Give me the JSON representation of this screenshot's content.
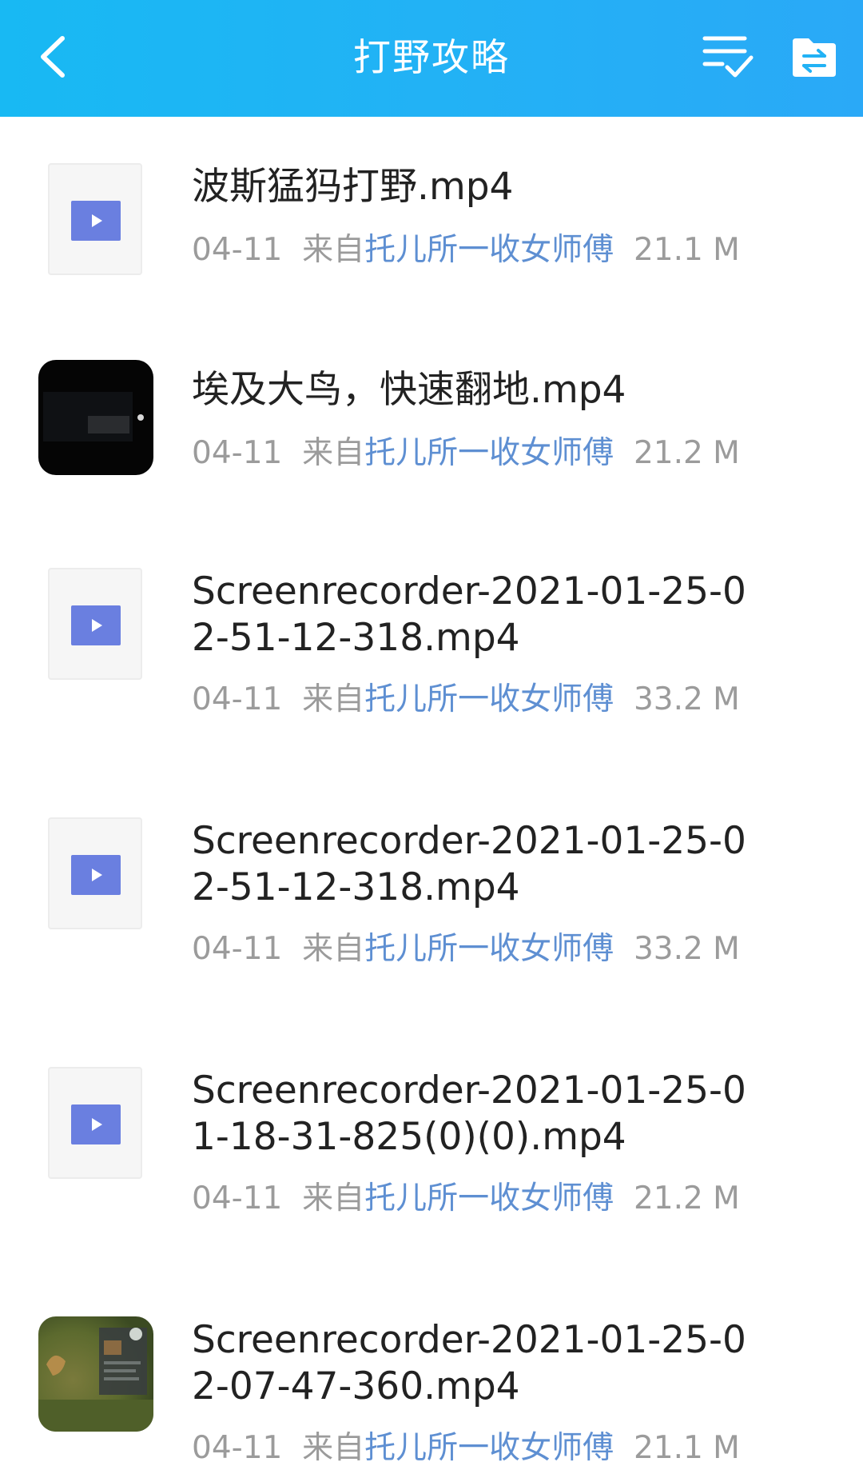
{
  "header": {
    "title": "打野攻略",
    "back_icon": "chevron-left-icon",
    "multi_select_icon": "checklist-icon",
    "folder_icon": "folder-transfer-icon",
    "background_color": "#1db5f4"
  },
  "files": [
    {
      "name": "波斯猛犸打野.mp4",
      "date": "04-11",
      "from_label": "来自",
      "source": "托儿所一收女师傅",
      "size": "21.1 M",
      "thumbnail": "video-placeholder-icon"
    },
    {
      "name": "埃及大鸟，快速翻地.mp4",
      "date": "04-11",
      "from_label": "来自",
      "source": "托儿所一收女师傅",
      "size": "21.2 M",
      "thumbnail": "dark-video-thumbnail"
    },
    {
      "name": "Screenrecorder-2021-01-25-02-51-12-318.mp4",
      "date": "04-11",
      "from_label": "来自",
      "source": "托儿所一收女师傅",
      "size": "33.2 M",
      "thumbnail": "video-placeholder-icon"
    },
    {
      "name": "Screenrecorder-2021-01-25-02-51-12-318.mp4",
      "date": "04-11",
      "from_label": "来自",
      "source": "托儿所一收女师傅",
      "size": "33.2 M",
      "thumbnail": "video-placeholder-icon"
    },
    {
      "name": "Screenrecorder-2021-01-25-01-18-31-825(0)(0).mp4",
      "date": "04-11",
      "from_label": "来自",
      "source": "托儿所一收女师傅",
      "size": "21.2 M",
      "thumbnail": "video-placeholder-icon"
    },
    {
      "name": "Screenrecorder-2021-01-25-02-07-47-360.mp4",
      "date": "04-11",
      "from_label": "来自",
      "source": "托儿所一收女师傅",
      "size": "21.1 M",
      "thumbnail": "game-video-thumbnail"
    }
  ],
  "colors": {
    "meta_gray": "#9b9b9b",
    "source_blue": "#5e8fd2",
    "play_icon": "#6a7fe0"
  }
}
